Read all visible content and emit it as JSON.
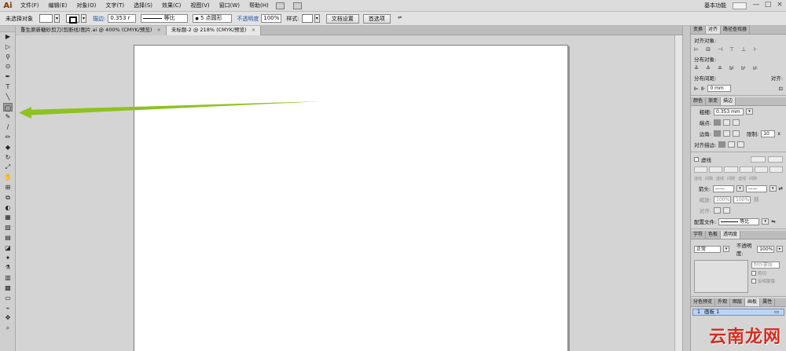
{
  "app": {
    "logo": "Ai",
    "workspace": "基本功能",
    "window_buttons": [
      "—",
      "□",
      "×"
    ]
  },
  "menu": [
    "文件(F)",
    "编辑(E)",
    "对象(O)",
    "文字(T)",
    "选择(S)",
    "效果(C)",
    "视图(V)",
    "窗口(W)",
    "帮助(H)"
  ],
  "control": {
    "selection": "未选择对象",
    "stroke_label": "描边:",
    "stroke_value": "0.353 r",
    "profile": "等比",
    "brush": "5 点圆形",
    "opacity_label": "不透明度",
    "opacity_value": "100%",
    "style_label": "样式:",
    "doc_setup": "文档设置",
    "preferences": "首选项"
  },
  "tabs": [
    {
      "label": "重生原新糖砂剪刀(剪断线)图片.ai @ 400% (CMYK/预览)",
      "close": "×"
    },
    {
      "label": "未标题-2 @ 218% (CMYK/预览)",
      "close": "×"
    }
  ],
  "tools": [
    "▶",
    "▷",
    "⚲",
    "⊙",
    "✒",
    "T",
    "╲",
    "◯",
    "✎",
    "∕",
    "✏",
    "◆",
    "↻",
    "⤢",
    "✋",
    "⊞",
    "⧉",
    "◐",
    "▦",
    "▨",
    "▤",
    "◪",
    "✦",
    "⚗",
    "▥",
    "▩",
    "▭",
    "⌁",
    "✥",
    "⌕",
    "⇆",
    "■",
    "⊘",
    "▢"
  ],
  "align_panel": {
    "tabs": [
      "变换",
      "对齐",
      "路径查找器"
    ],
    "align_objects": "对齐对象:",
    "distribute_objects": "分布对象:",
    "distribute_spacing": "分布间距:",
    "align_to": "对齐:",
    "spacing_value": "0 mm",
    "align_icons": [
      "⊨",
      "⊟",
      "⊣",
      "⊤",
      "⊥",
      "⊦"
    ],
    "distribute_icons": [
      "≚",
      "≙",
      "≘",
      "⊯",
      "⊮",
      "⊭"
    ]
  },
  "stroke_panel": {
    "tabs": [
      "颜色",
      "渐变",
      "描边"
    ],
    "weight_label": "粗细:",
    "weight_value": "0.353 mm",
    "cap_label": "端点:",
    "corner_label": "边角:",
    "limit_label": "限制:",
    "limit_value": "10",
    "limit_unit": "x",
    "align_label": "对齐描边:",
    "dashed_label": "虚线",
    "dash_labels": [
      "虚线",
      "间隙",
      "虚线",
      "间隙",
      "虚线",
      "间隙"
    ],
    "arrow_label": "箭头:",
    "scale_label": "缩放:",
    "scale_value1": "100%",
    "scale_value2": "100%",
    "align_arrow_label": "对齐:",
    "profile_label": "配置文件:",
    "profile_value": "等比"
  },
  "transparency_panel": {
    "tabs": [
      "字符",
      "色板",
      "透明度"
    ],
    "mode": "正常",
    "opacity_label": "不透明度:",
    "opacity_value": "100%",
    "make_mask": "制作蒙版",
    "clip": "剪切",
    "invert": "反相蒙版"
  },
  "artboards_panel": {
    "tabs": [
      "分色预览",
      "外观",
      "图层",
      "画板",
      "属性"
    ],
    "rows": [
      {
        "num": "1",
        "name": "画板 1"
      }
    ]
  },
  "watermark": "云南龙网",
  "annotation": {
    "arrow_color": "#8dc21f"
  }
}
